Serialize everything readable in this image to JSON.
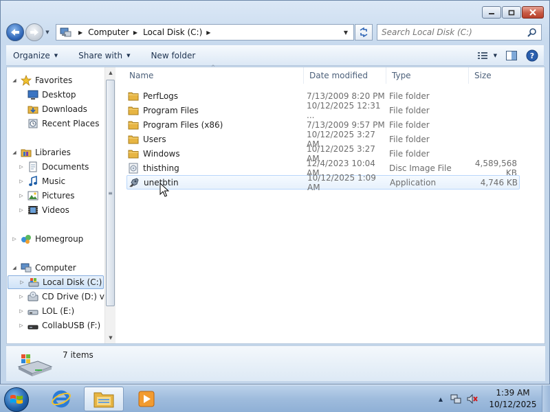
{
  "address_bar": {
    "crumbs": [
      "Computer",
      "Local Disk (C:)"
    ]
  },
  "search": {
    "placeholder": "Search Local Disk (C:)"
  },
  "toolbar": {
    "organize": "Organize",
    "share_with": "Share with",
    "new_folder": "New folder"
  },
  "nav_pane": {
    "favorites": "Favorites",
    "desktop": "Desktop",
    "downloads": "Downloads",
    "recent_places": "Recent Places",
    "libraries": "Libraries",
    "documents": "Documents",
    "music": "Music",
    "pictures": "Pictures",
    "videos": "Videos",
    "homegroup": "Homegroup",
    "computer": "Computer",
    "local_disk": "Local Disk (C:)",
    "cd_drive": "CD Drive (D:) virt",
    "lol": "LOL (E:)",
    "collabusb": "CollabUSB (F:)"
  },
  "columns": {
    "name": "Name",
    "date_modified": "Date modified",
    "type": "Type",
    "size": "Size"
  },
  "files": [
    {
      "name": "PerfLogs",
      "date": "7/13/2009 8:20 PM",
      "type": "File folder",
      "size": "",
      "icon": "folder-icon"
    },
    {
      "name": "Program Files",
      "date": "10/12/2025 12:31 ...",
      "type": "File folder",
      "size": "",
      "icon": "folder-icon"
    },
    {
      "name": "Program Files (x86)",
      "date": "7/13/2009 9:57 PM",
      "type": "File folder",
      "size": "",
      "icon": "folder-icon"
    },
    {
      "name": "Users",
      "date": "10/12/2025 3:27 AM",
      "type": "File folder",
      "size": "",
      "icon": "folder-icon"
    },
    {
      "name": "Windows",
      "date": "10/12/2025 3:27 AM",
      "type": "File folder",
      "size": "",
      "icon": "folder-icon"
    },
    {
      "name": "thisthing",
      "date": "12/4/2023 10:04 AM",
      "type": "Disc Image File",
      "size": "4,589,568 KB",
      "icon": "disc-image-icon"
    },
    {
      "name": "unetbtin",
      "date": "10/12/2025 1:09 AM",
      "type": "Application",
      "size": "4,746 KB",
      "icon": "application-icon"
    }
  ],
  "details": {
    "item_count": "7 items"
  },
  "taskbar": {
    "time": "1:39 AM",
    "date": "10/12/2025"
  },
  "colors": {
    "folder": "#e7b543",
    "selection": "#cfe3f8",
    "accent": "#2c63b5"
  }
}
